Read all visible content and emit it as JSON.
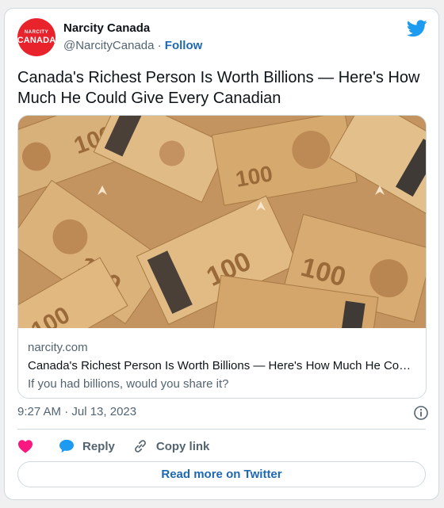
{
  "author": {
    "name": "Narcity Canada",
    "handle": "@NarcityCanada",
    "separator": "·",
    "follow_label": "Follow",
    "avatar_text_line1": "NARCITY",
    "avatar_text_line2": "CANADA"
  },
  "tweet": {
    "text": "Canada's Richest Person Is Worth Billions — Here's How Much He Could Give Every Canadian",
    "timestamp": "9:27 AM · Jul 13, 2023"
  },
  "link_card": {
    "domain": "narcity.com",
    "title": "Canada's Richest Person Is Worth Billions — Here's How Much He Co…",
    "description": "If you had billions, would you share it?",
    "image_icon": "canadian-100-dollar-bills-image"
  },
  "actions": {
    "like_icon": "heart-icon",
    "reply_label": "Reply",
    "copy_label": "Copy link"
  },
  "read_more_label": "Read more on Twitter",
  "colors": {
    "link_blue": "#1d68b3",
    "twitter_blue": "#1d9bf0",
    "heart": "#f91880",
    "avatar_red": "#e8232b",
    "bill_tan": "#c59a62"
  }
}
